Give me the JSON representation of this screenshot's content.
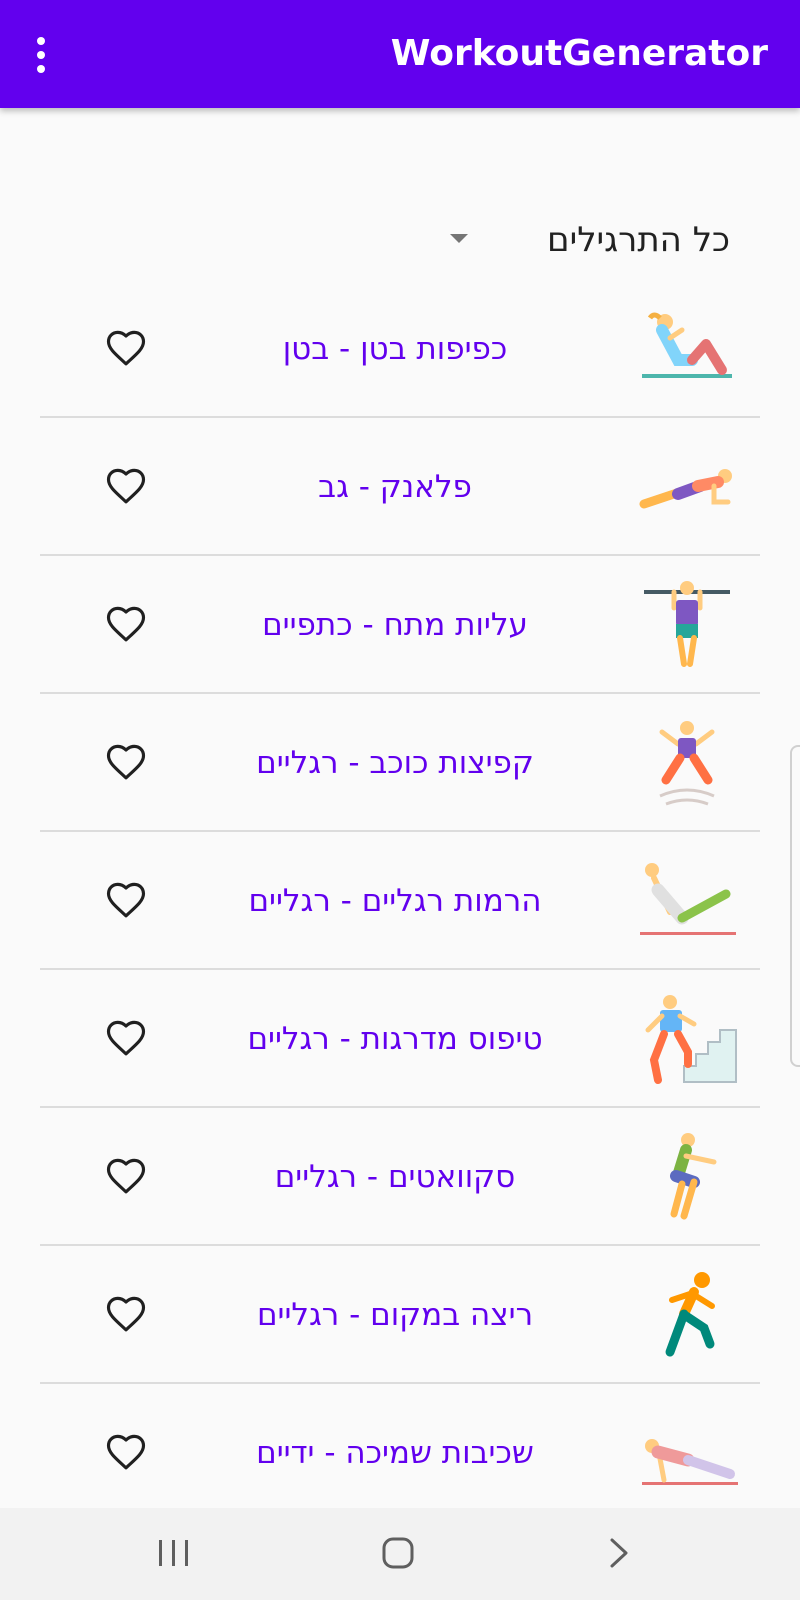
{
  "app": {
    "title": "WorkoutGenerator",
    "accent_color": "#6200ee"
  },
  "appbar": {
    "menu_icon": "more-vert-icon"
  },
  "filter": {
    "selected": "כל התרגילים",
    "icon": "dropdown-arrow-icon"
  },
  "exercises": [
    {
      "name": "כפיפות בטן - בטן",
      "icon": "situps-icon"
    },
    {
      "name": "פלאנק - גב",
      "icon": "plank-icon"
    },
    {
      "name": "עליות מתח - כתפיים",
      "icon": "pullups-icon"
    },
    {
      "name": "קפיצות כוכב - רגליים",
      "icon": "jumping-jacks-icon"
    },
    {
      "name": "הרמות רגליים - רגליים",
      "icon": "leg-raises-icon"
    },
    {
      "name": "טיפוס מדרגות - רגליים",
      "icon": "stair-climbing-icon"
    },
    {
      "name": "סקוואטים - רגליים",
      "icon": "squats-icon"
    },
    {
      "name": "ריצה במקום - רגליים",
      "icon": "running-icon"
    },
    {
      "name": "שכיבות שמיכה - ידיים",
      "icon": "pushups-icon"
    }
  ],
  "favorite_icon": "heart-outline-icon",
  "system_nav": {
    "recent": "recent-apps-icon",
    "home": "home-icon",
    "back": "back-icon"
  }
}
